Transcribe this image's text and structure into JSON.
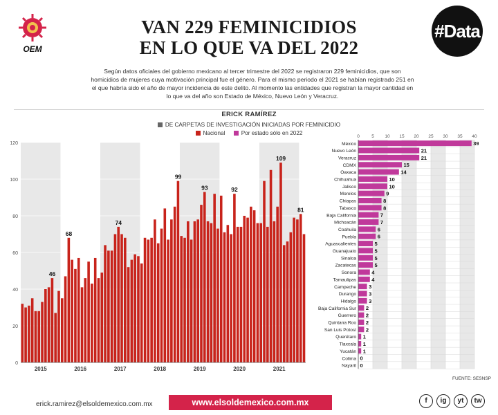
{
  "header": {
    "title_line1": "VAN 229 FEMINICIDIOS",
    "title_line2": "EN LO QUE VA DEL 2022",
    "data_tag": "#Data",
    "logo_text": "OEM"
  },
  "intro": "Según datos oficiales del gobierno mexicano al tercer trimestre del 2022 se registraron 229 feminicidios, que son homicidios de mujeres cuya motivación principal fue el género. Para el mismo periodo el 2021 se habían registrado 251 en el que habría sido el año de mayor incidencia de este delito. Al momento las entidades que registran la mayor cantidad en lo que va del año son Estado de México, Nuevo León y Veracruz.",
  "byline": "ERICK RAMÍREZ",
  "legend": {
    "title": "DE CARPETAS DE INVESTIGACIÓN INICIADAS POR FEMINICIDIO",
    "national": "Nacional",
    "state": "Por estado sólo en 2022"
  },
  "colors": {
    "bar": "#c8231b",
    "state_bar": "#c0399b",
    "accent": "#d4234a",
    "band": "#e8e8e8"
  },
  "chart_data": [
    {
      "type": "bar",
      "series": [
        {
          "name": "Nacional",
          "values": [
            32,
            30,
            31,
            35,
            28,
            28,
            33,
            40,
            41,
            46,
            27,
            39,
            35,
            47,
            68,
            56,
            51,
            57,
            41,
            46,
            55,
            43,
            57,
            46,
            49,
            64,
            61,
            61,
            70,
            74,
            70,
            68,
            52,
            56,
            59,
            58,
            54,
            68,
            67,
            68,
            78,
            65,
            73,
            84,
            67,
            78,
            85,
            99,
            69,
            68,
            77,
            67,
            77,
            78,
            86,
            93,
            77,
            76,
            92,
            73,
            91,
            71,
            75,
            70,
            92,
            74,
            74,
            80,
            79,
            85,
            83,
            76,
            76,
            99,
            74,
            105,
            77,
            85,
            109,
            64,
            66,
            71,
            79,
            78,
            81,
            70
          ]
        }
      ],
      "xticks": [
        "2015",
        "2016",
        "2017",
        "2018",
        "2019",
        "2020",
        "2021",
        "2022"
      ],
      "ylim": [
        0,
        120
      ],
      "yticks": [
        0,
        20,
        40,
        60,
        80,
        100,
        120
      ],
      "annotations": [
        {
          "index": 9,
          "label": "46"
        },
        {
          "index": 14,
          "label": "68"
        },
        {
          "index": 29,
          "label": "74"
        },
        {
          "index": 47,
          "label": "99"
        },
        {
          "index": 55,
          "label": "93"
        },
        {
          "index": 64,
          "label": "92"
        },
        {
          "index": 78,
          "label": "109"
        },
        {
          "index": 84,
          "label": "81"
        }
      ],
      "grid": true
    },
    {
      "type": "bar",
      "orientation": "horizontal",
      "categories": [
        "México",
        "Nuevo León",
        "Veracruz",
        "CDMX",
        "Oaxaca",
        "Chihuahua",
        "Jalisco",
        "Morelos",
        "Chiapas",
        "Tabasco",
        "Baja California",
        "Michoacán",
        "Coahuila",
        "Puebla",
        "Aguascalientes",
        "Guanajuato",
        "Sinaloa",
        "Zacatecas",
        "Sonora",
        "Tamaulipas",
        "Campeche",
        "Durango",
        "Hidalgo",
        "Baja California Sur",
        "Guerrero",
        "Quintana Roo",
        "San Luis Potosí",
        "Querétaro",
        "Tlaxcala",
        "Yucatán",
        "Colima",
        "Nayarit"
      ],
      "series": [
        {
          "name": "Por estado sólo en 2022",
          "values": [
            39,
            21,
            21,
            15,
            14,
            10,
            10,
            9,
            8,
            8,
            7,
            7,
            6,
            6,
            5,
            5,
            5,
            5,
            4,
            4,
            3,
            3,
            3,
            2,
            2,
            2,
            2,
            1,
            1,
            1,
            0,
            0
          ]
        }
      ],
      "xlim": [
        0,
        40
      ],
      "xticks": [
        0,
        5,
        10,
        15,
        20,
        25,
        30,
        35,
        40
      ]
    }
  ],
  "source": "FUENTE: SESNSP",
  "footer": {
    "email": "erick.ramirez@elsoldemexico.com.mx",
    "url": "www.elsoldemexico.com.mx",
    "social": [
      "f",
      "ig",
      "yt",
      "tw"
    ]
  }
}
